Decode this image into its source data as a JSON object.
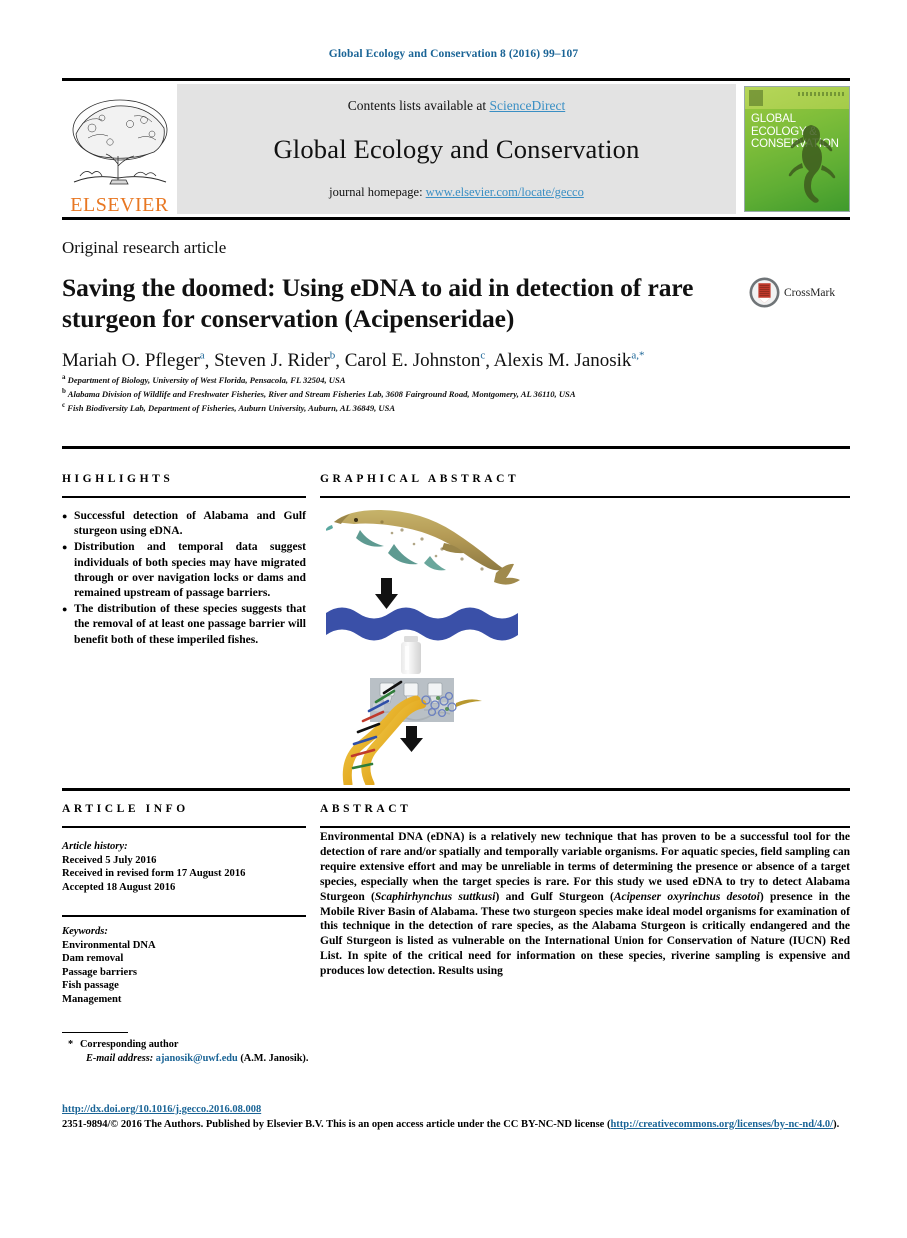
{
  "running_head": "Global Ecology and Conservation 8 (2016) 99–107",
  "masthead": {
    "publisher": "ELSEVIER",
    "contents_prefix": "Contents lists available at ",
    "contents_link": "ScienceDirect",
    "journal_name": "Global Ecology and Conservation",
    "homepage_prefix": "journal homepage: ",
    "homepage_link": "www.elsevier.com/locate/gecco",
    "cover_title": "GLOBAL ECOLOGY & CONSERVATION"
  },
  "article": {
    "type": "Original research article",
    "title": "Saving the doomed: Using eDNA to aid in detection of rare sturgeon for conservation (Acipenseridae)",
    "crossmark_label": "CrossMark",
    "authors": [
      {
        "name": "Mariah O. Pfleger",
        "mark": "a"
      },
      {
        "name": "Steven J. Rider",
        "mark": "b"
      },
      {
        "name": "Carol E. Johnston",
        "mark": "c"
      },
      {
        "name": "Alexis M. Janosik",
        "mark": "a,*"
      }
    ],
    "affiliations": [
      {
        "mark": "a",
        "text": "Department of Biology, University of West Florida, Pensacola, FL 32504, USA"
      },
      {
        "mark": "b",
        "text": "Alabama Division of Wildlife and Freshwater Fisheries, River and Stream Fisheries Lab, 3608 Fairground Road, Montgomery, AL 36110, USA"
      },
      {
        "mark": "c",
        "text": "Fish Biodiversity Lab, Department of Fisheries, Auburn University, Auburn, AL 36849, USA"
      }
    ]
  },
  "sections": {
    "highlights_heading": "HIGHLIGHTS",
    "graphical_abstract_heading": "GRAPHICAL ABSTRACT",
    "article_info_heading": "ARTICLE INFO",
    "abstract_heading": "ABSTRACT"
  },
  "highlights": [
    "Successful detection of Alabama and Gulf sturgeon using eDNA.",
    "Distribution and temporal data suggest individuals of both species may have migrated through or over navigation locks or dams and remained upstream of passage barriers.",
    "The distribution of these species suggests that the removal of at least one passage barrier will benefit both of these imperiled fishes."
  ],
  "article_info": {
    "history_label": "Article history:",
    "history": [
      "Received 5 July 2016",
      "Received in revised form 17 August 2016",
      "Accepted 18 August 2016"
    ],
    "keywords_label": "Keywords:",
    "keywords": [
      "Environmental DNA",
      "Dam removal",
      "Passage barriers",
      "Fish passage",
      "Management"
    ]
  },
  "abstract": {
    "part1": "Environmental DNA (eDNA) is a relatively new technique that has proven to be a successful tool for the detection of rare and/or spatially and temporally variable organisms. For aquatic species, field sampling can require extensive effort and may be unreliable in terms of determining the presence or absence of a target species, especially when the target species is rare. For this study we used eDNA to try to detect Alabama Sturgeon (",
    "species1": "Scaphirhynchus suttkusi",
    "part2": ") and Gulf Sturgeon (",
    "species2": "Acipenser oxyrinchus desotoi",
    "part3": ") presence in the Mobile River Basin of Alabama. These two sturgeon species make ideal model organisms for examination of this technique in the detection of rare species, as the Alabama Sturgeon is critically endangered and the Gulf Sturgeon is listed as vulnerable on the International Union for Conservation of Nature (IUCN) Red List. In spite of the critical need for information on these species, riverine sampling is expensive and produces low detection. Results using"
  },
  "footer": {
    "corresponding_marker": "*",
    "corresponding_label": "Corresponding author",
    "email_label": "E-mail address:",
    "email": "ajanosik@uwf.edu",
    "email_suffix": "(A.M. Janosik).",
    "doi": "http://dx.doi.org/10.1016/j.gecco.2016.08.008",
    "copyright_pre": "2351-9894/© 2016 The Authors. Published by Elsevier B.V. This is an open access article under the CC BY-NC-ND license (",
    "license_url_1": "http://creativecommons.org/",
    "license_url_2": "licenses/by-nc-nd/4.0/",
    "copyright_post": ")."
  },
  "graphical_abstract": {
    "step_1": "sturgeon-fish",
    "step_2": "river-water",
    "step_3": "water-sample-bottle",
    "step_4": "filtration-apparatus",
    "step_5": "dna-double-helix"
  },
  "colors": {
    "link": "#1a6496",
    "science_direct": "#3a8fc4",
    "elsevier_orange": "#e87722",
    "water_blue": "#3a50a8",
    "dna_gold": "#e8b838",
    "cover_green": "#7fbe3a"
  }
}
